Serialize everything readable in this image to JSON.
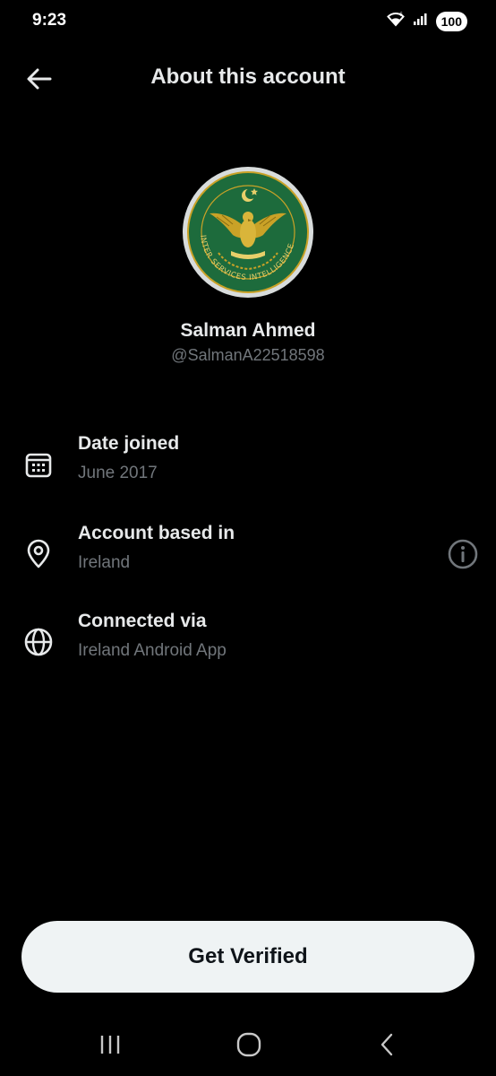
{
  "status_bar": {
    "time": "9:23",
    "battery": "100",
    "icons": [
      "wifi-icon",
      "signal-icon",
      "battery-icon"
    ]
  },
  "header": {
    "title": "About this account",
    "back_icon": "back-arrow-icon"
  },
  "profile": {
    "name": "Salman Ahmed",
    "handle": "@SalmanA22518598",
    "avatar_icon": "inter-services-intelligence-emblem"
  },
  "info": [
    {
      "icon": "calendar-icon",
      "title": "Date joined",
      "value": "June 2017"
    },
    {
      "icon": "location-pin-icon",
      "title": "Account based in",
      "value": "Ireland",
      "action_icon": "info-icon"
    },
    {
      "icon": "globe-icon",
      "title": "Connected via",
      "value": "Ireland Android App"
    }
  ],
  "footer": {
    "button_label": "Get Verified"
  },
  "nav": {
    "icons": [
      "recent-apps-icon",
      "home-icon",
      "back-icon"
    ]
  },
  "colors": {
    "background": "#000000",
    "text_primary": "#e7e9ea",
    "text_secondary": "#71767b",
    "button_bg": "#eff3f4",
    "emblem_green": "#1d6b3c",
    "emblem_gold": "#c9a227"
  }
}
